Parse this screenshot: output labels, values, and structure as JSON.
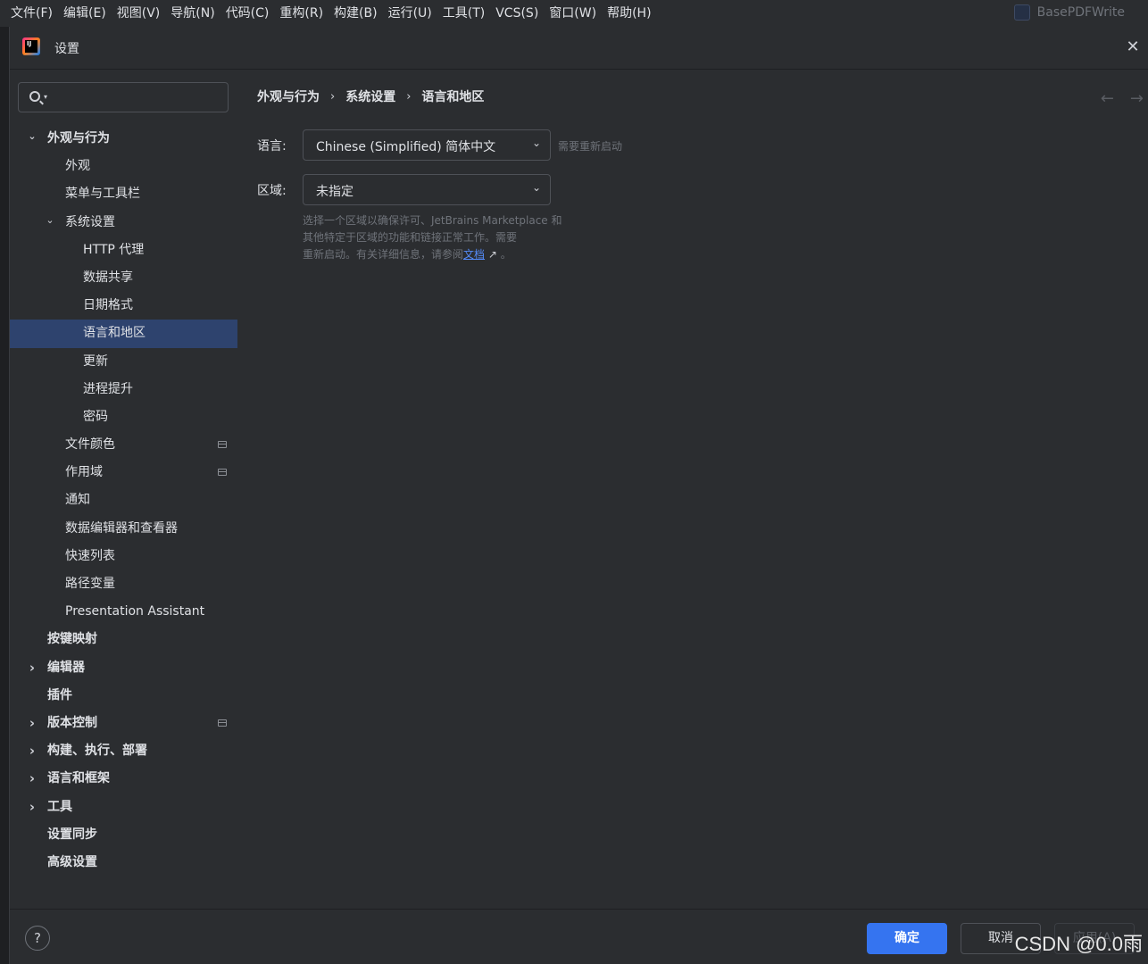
{
  "menubar": {
    "items": [
      "文件(F)",
      "编辑(E)",
      "视图(V)",
      "导航(N)",
      "代码(C)",
      "重构(R)",
      "构建(B)",
      "运行(U)",
      "工具(T)",
      "VCS(S)",
      "窗口(W)",
      "帮助(H)"
    ],
    "project_name": "BasePDFWrite"
  },
  "dialog": {
    "title": "设置"
  },
  "sidebar": {
    "search_placeholder": "",
    "items": [
      {
        "label": "外观与行为",
        "level": 0,
        "bold": true,
        "chevron": "open"
      },
      {
        "label": "外观",
        "level": 1
      },
      {
        "label": "菜单与工具栏",
        "level": 1
      },
      {
        "label": "系统设置",
        "level": 1,
        "chevron": "open"
      },
      {
        "label": "HTTP 代理",
        "level": 2
      },
      {
        "label": "数据共享",
        "level": 2
      },
      {
        "label": "日期格式",
        "level": 2
      },
      {
        "label": "语言和地区",
        "level": 2,
        "selected": true
      },
      {
        "label": "更新",
        "level": 2
      },
      {
        "label": "进程提升",
        "level": 2
      },
      {
        "label": "密码",
        "level": 2
      },
      {
        "label": "文件颜色",
        "level": 1,
        "project_icon": true
      },
      {
        "label": "作用域",
        "level": 1,
        "project_icon": true
      },
      {
        "label": "通知",
        "level": 1
      },
      {
        "label": "数据编辑器和查看器",
        "level": 1
      },
      {
        "label": "快速列表",
        "level": 1
      },
      {
        "label": "路径变量",
        "level": 1
      },
      {
        "label": "Presentation Assistant",
        "level": 1
      },
      {
        "label": "按键映射",
        "level": 0,
        "bold": true
      },
      {
        "label": "编辑器",
        "level": 0,
        "bold": true,
        "chevron": "closed"
      },
      {
        "label": "插件",
        "level": 0,
        "bold": true
      },
      {
        "label": "版本控制",
        "level": 0,
        "bold": true,
        "chevron": "closed",
        "project_icon": true
      },
      {
        "label": "构建、执行、部署",
        "level": 0,
        "bold": true,
        "chevron": "closed"
      },
      {
        "label": "语言和框架",
        "level": 0,
        "bold": true,
        "chevron": "closed"
      },
      {
        "label": "工具",
        "level": 0,
        "bold": true,
        "chevron": "closed"
      },
      {
        "label": "设置同步",
        "level": 0,
        "bold": true
      },
      {
        "label": "高级设置",
        "level": 0,
        "bold": true
      }
    ]
  },
  "main": {
    "breadcrumb": [
      "外观与行为",
      "系统设置",
      "语言和地区"
    ],
    "language": {
      "label": "语言:",
      "value": "Chinese (Simplified) 简体中文",
      "hint": "需要重新启动"
    },
    "region": {
      "label": "区域:",
      "value": "未指定",
      "description_line1": "选择一个区域以确保许可、JetBrains Marketplace 和",
      "description_line2": "其他特定于区域的功能和链接正常工作。需要",
      "description_line3_prefix": "重新启动。有关详细信息，请参阅",
      "link_text": "文档",
      "description_suffix": " 。"
    }
  },
  "footer": {
    "help": "?",
    "ok": "确定",
    "cancel": "取消",
    "apply": "应用(A)"
  },
  "watermark": "CSDN @0.0雨"
}
